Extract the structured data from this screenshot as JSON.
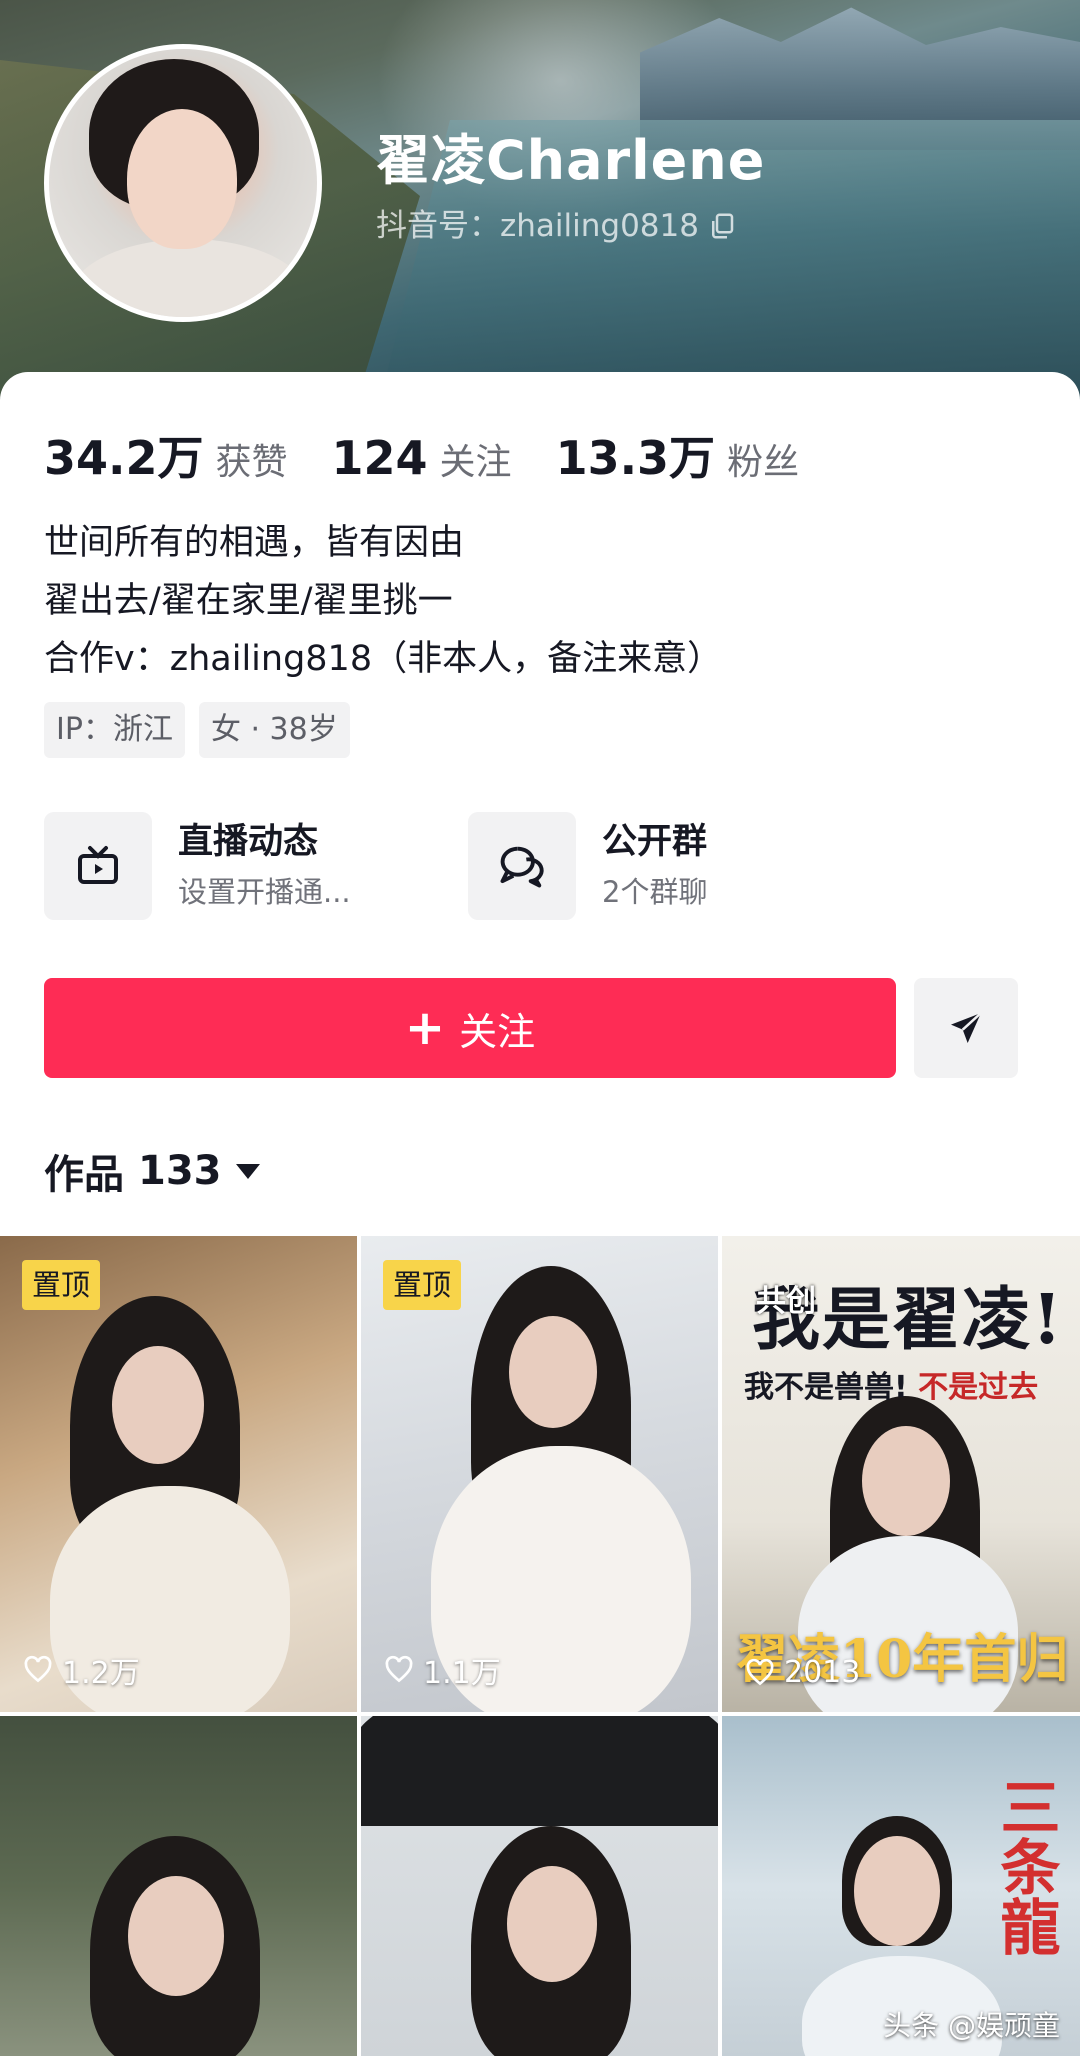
{
  "profile": {
    "name": "翟凌Charlene",
    "douyin_id": "抖音号：zhailing0818"
  },
  "stats": [
    {
      "value": "34.2万",
      "label": "获赞"
    },
    {
      "value": "124",
      "label": "关注"
    },
    {
      "value": "13.3万",
      "label": "粉丝"
    }
  ],
  "bio": {
    "line1": "世间所有的相遇，皆有因由",
    "line2": "翟出去/翟在家里/翟里挑一",
    "line3": "合作v：zhailing818（非本人，备注来意）"
  },
  "tags": [
    "IP：浙江",
    "女 · 38岁"
  ],
  "features": {
    "live": {
      "title": "直播动态",
      "subtitle": "设置开播通..."
    },
    "group": {
      "title": "公开群",
      "subtitle": "2个群聊"
    }
  },
  "actions": {
    "follow_label": "关注",
    "follow_plus": "+"
  },
  "works": {
    "label": "作品",
    "count": "133"
  },
  "videos": [
    {
      "pinned": "置顶",
      "likes": "1.2万"
    },
    {
      "pinned": "置顶",
      "likes": "1.1万"
    },
    {
      "likes": "2013",
      "badge": "共创",
      "title": "我是翟凌!",
      "subtitle_a": "我不是兽兽!",
      "subtitle_b": "不是过去",
      "bottom_text": "翟凌10年首归"
    },
    {},
    {},
    {
      "calligraphy": "三条龍"
    }
  ],
  "watermark": "头条 @娱顽童",
  "colors": {
    "accent": "#fe2c55",
    "pin_badge": "#f8d44a",
    "text_primary": "#161823",
    "text_secondary": "#6b6d75"
  },
  "icons": {
    "copy": "copy-icon",
    "live": "tv-icon",
    "group": "chat-bubbles-icon",
    "share": "send-icon",
    "caret": "caret-down-icon",
    "likes": "heart-icon"
  }
}
